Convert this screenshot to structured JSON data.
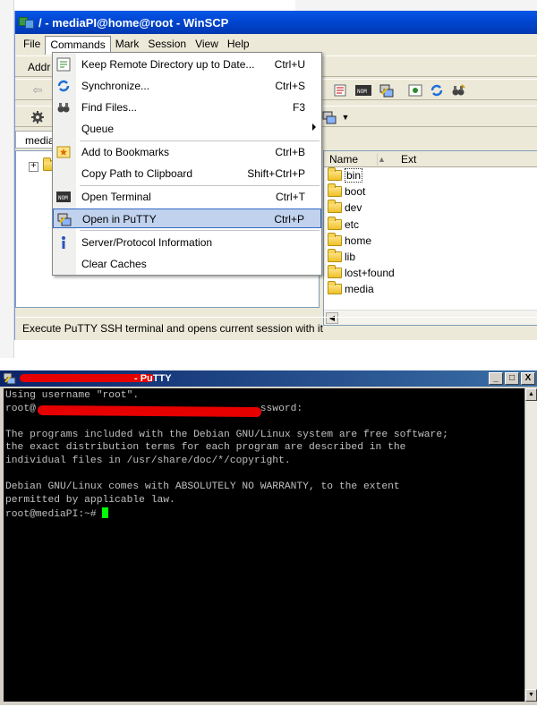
{
  "winscp": {
    "title": "/ - mediaPI@home@root - WinSCP",
    "menu": [
      "File",
      "Commands",
      "Mark",
      "Session",
      "View",
      "Help"
    ],
    "address_label": "Addr",
    "session_tab": "media",
    "files_header": {
      "name": "Name",
      "ext": "Ext"
    },
    "files": [
      "bin",
      "boot",
      "dev",
      "etc",
      "home",
      "lib",
      "lost+found",
      "media"
    ],
    "selected_file": "bin",
    "status": "Execute PuTTY SSH terminal and opens current session with it"
  },
  "commands_menu": {
    "items": [
      {
        "label": "Keep Remote Directory up to Date...",
        "shortcut": "Ctrl+U",
        "icon": "keep-dir-icon"
      },
      {
        "label": "Synchronize...",
        "shortcut": "Ctrl+S",
        "icon": "synchronize-icon"
      },
      {
        "label": "Find Files...",
        "shortcut": "F3",
        "icon": "binoculars-icon"
      },
      {
        "label": "Queue",
        "shortcut": "",
        "icon": "",
        "submenu": true
      },
      {
        "label": "Add to Bookmarks",
        "shortcut": "Ctrl+B",
        "icon": "bookmark-icon"
      },
      {
        "label": "Copy Path to Clipboard",
        "shortcut": "Shift+Ctrl+P",
        "icon": ""
      },
      {
        "label": "Open Terminal",
        "shortcut": "Ctrl+T",
        "icon": "terminal-icon"
      },
      {
        "label": "Open in PuTTY",
        "shortcut": "Ctrl+P",
        "icon": "putty-icon",
        "highlighted": true
      },
      {
        "label": "Server/Protocol Information",
        "shortcut": "",
        "icon": "info-icon"
      },
      {
        "label": "Clear Caches",
        "shortcut": "",
        "icon": ""
      }
    ]
  },
  "putty": {
    "title_suffix": " - PuTTY",
    "controls": [
      "_",
      "□",
      "X"
    ],
    "lines": [
      "Using username \"root\".",
      "root@                                     ssword:",
      "",
      "The programs included with the Debian GNU/Linux system are free software;",
      "the exact distribution terms for each program are described in the",
      "individual files in /usr/share/doc/*/copyright.",
      "",
      "Debian GNU/Linux comes with ABSOLUTELY NO WARRANTY, to the extent",
      "permitted by applicable law."
    ],
    "prompt": "root@mediaPI:~# "
  },
  "colors": {
    "xp_title_blue": "#0047d4",
    "menu_highlight": "#c1d2ee",
    "putty_title": "#0a246a",
    "terminal_bg": "#000000",
    "terminal_fg": "#c0c0c0",
    "cursor": "#00ff00",
    "redaction": "#e60000"
  }
}
